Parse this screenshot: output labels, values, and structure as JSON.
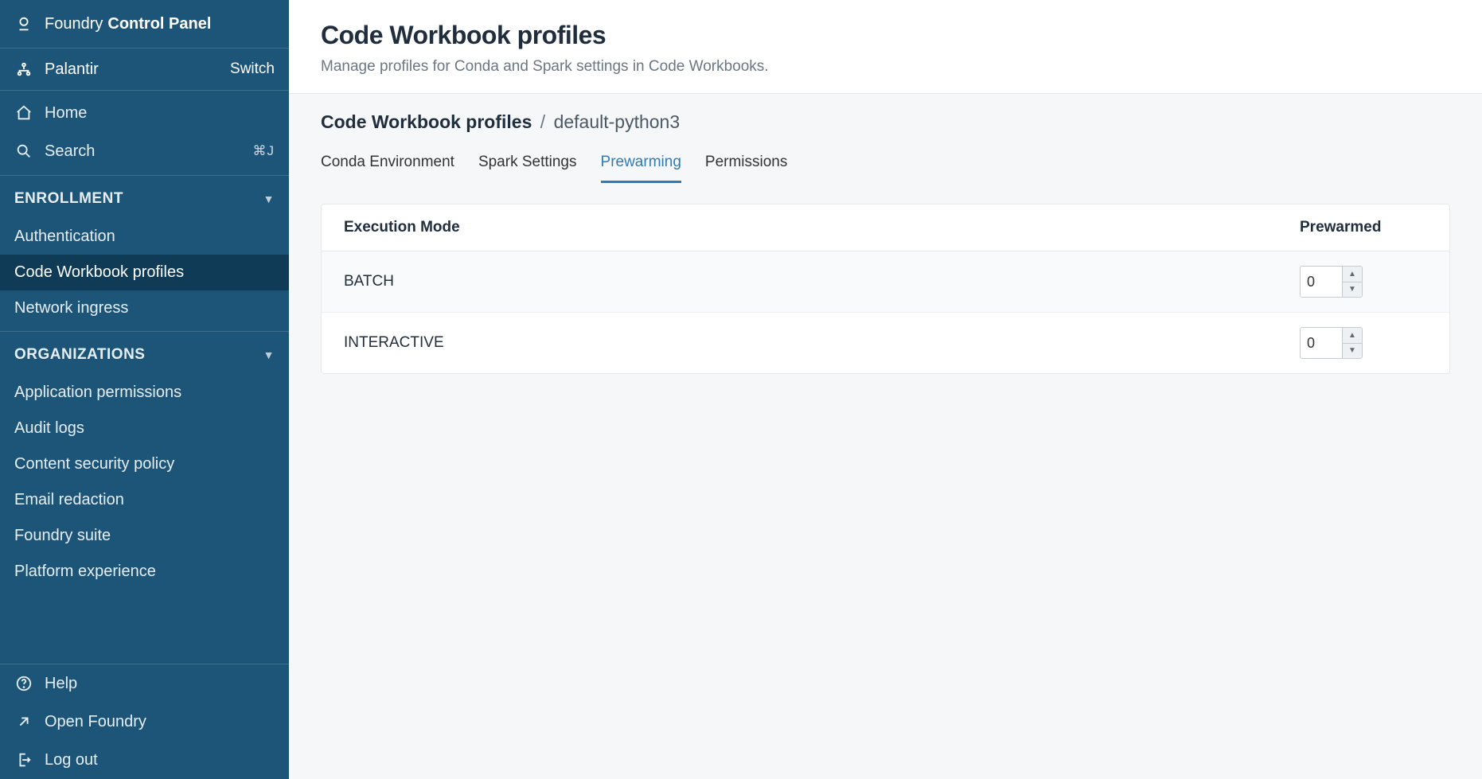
{
  "app": {
    "name_light": "Foundry",
    "name_bold": "Control Panel"
  },
  "org": {
    "name": "Palantir",
    "switch_label": "Switch"
  },
  "nav": {
    "home": "Home",
    "search": "Search",
    "search_shortcut": "⌘J"
  },
  "sections": {
    "enrollment": {
      "label": "Enrollment",
      "items": [
        {
          "label": "Authentication"
        },
        {
          "label": "Code Workbook profiles",
          "selected": true
        },
        {
          "label": "Network ingress"
        }
      ]
    },
    "organizations": {
      "label": "Organizations",
      "items": [
        {
          "label": "Application permissions"
        },
        {
          "label": "Audit logs"
        },
        {
          "label": "Content security policy"
        },
        {
          "label": "Email redaction"
        },
        {
          "label": "Foundry suite"
        },
        {
          "label": "Platform experience"
        }
      ]
    }
  },
  "footer": {
    "help": "Help",
    "open": "Open Foundry",
    "logout": "Log out"
  },
  "page": {
    "title": "Code Workbook profiles",
    "subtitle": "Manage profiles for Conda and Spark settings in Code Workbooks."
  },
  "breadcrumb": {
    "root": "Code Workbook profiles",
    "sep": "/",
    "leaf": "default-python3"
  },
  "tabs": [
    {
      "label": "Conda Environment"
    },
    {
      "label": "Spark Settings"
    },
    {
      "label": "Prewarming",
      "active": true
    },
    {
      "label": "Permissions"
    }
  ],
  "table": {
    "col_mode": "Execution Mode",
    "col_prewarmed": "Prewarmed",
    "rows": [
      {
        "mode": "BATCH",
        "value": "0"
      },
      {
        "mode": "INTERACTIVE",
        "value": "0"
      }
    ]
  }
}
